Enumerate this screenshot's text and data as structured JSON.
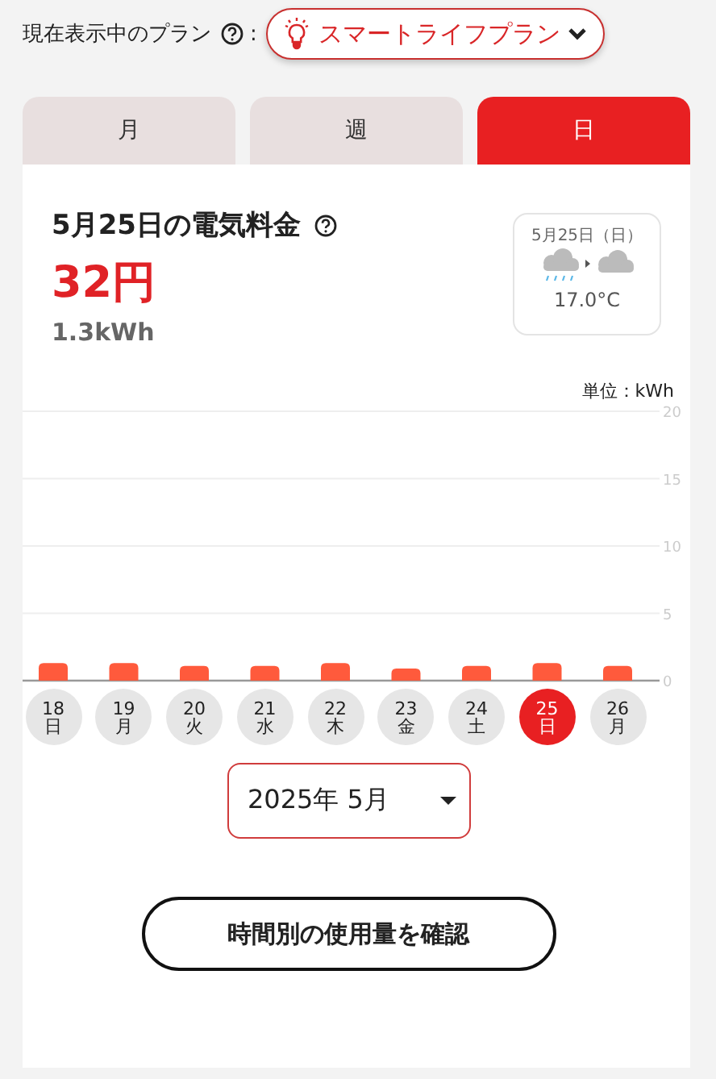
{
  "plan_bar": {
    "label": "現在表示中のプラン",
    "separator": ":",
    "plan": "スマートライフプラン"
  },
  "tabs": [
    {
      "label": "月",
      "selected": false
    },
    {
      "label": "週",
      "selected": false
    },
    {
      "label": "日",
      "selected": true
    }
  ],
  "summary": {
    "title": "5月25日の電気料金",
    "price": "32円",
    "usage": "1.3kWh"
  },
  "weather": {
    "date": "5月25日（日）",
    "temperature": "17.0°C"
  },
  "chart": {
    "unit_label": "単位：kWh",
    "chart_data": {
      "type": "bar",
      "grid": true,
      "ylim": [
        0,
        20
      ],
      "yticks": [
        0,
        5,
        10,
        15,
        20
      ],
      "series": [
        {
          "color": "#ff5a3c",
          "values": [
            1.3,
            1.3,
            1.1,
            1.1,
            1.3,
            0.9,
            1.1,
            1.3,
            1.1
          ]
        }
      ]
    }
  },
  "days": [
    {
      "date": "18",
      "weekday": "日",
      "selected": false
    },
    {
      "date": "19",
      "weekday": "月",
      "selected": false
    },
    {
      "date": "20",
      "weekday": "火",
      "selected": false
    },
    {
      "date": "21",
      "weekday": "水",
      "selected": false
    },
    {
      "date": "22",
      "weekday": "木",
      "selected": false
    },
    {
      "date": "23",
      "weekday": "金",
      "selected": false
    },
    {
      "date": "24",
      "weekday": "土",
      "selected": false
    },
    {
      "date": "25",
      "weekday": "日",
      "selected": true
    },
    {
      "date": "26",
      "weekday": "月",
      "selected": false
    }
  ],
  "month_select": {
    "value": "2025年 5月"
  },
  "hourly_button": {
    "label": "時間別の使用量を確認"
  }
}
